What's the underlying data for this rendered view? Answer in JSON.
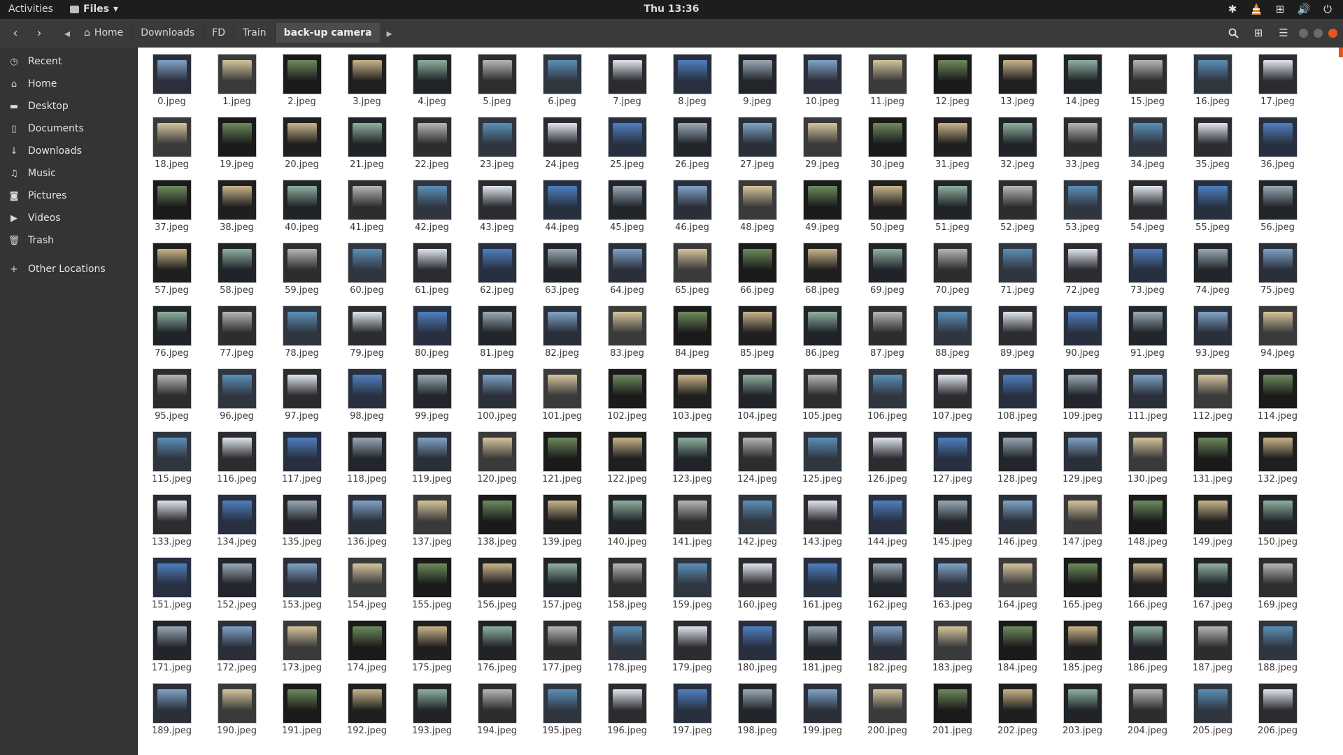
{
  "topbar": {
    "activities": "Activities",
    "app_name": "Files",
    "clock": "Thu 13:36",
    "tray_icons": [
      "settings-icon",
      "vlc-icon",
      "network-icon",
      "volume-icon",
      "power-icon"
    ]
  },
  "headerbar": {
    "breadcrumbs": [
      "Home",
      "Downloads",
      "FD",
      "Train",
      "back-up camera"
    ],
    "icons": [
      "back-icon",
      "forward-icon",
      "search-icon",
      "view-grid-icon",
      "menu-icon"
    ]
  },
  "sidebar": {
    "items": [
      {
        "label": "Recent",
        "icon": "clock-icon"
      },
      {
        "label": "Home",
        "icon": "home-icon"
      },
      {
        "label": "Desktop",
        "icon": "folder-icon"
      },
      {
        "label": "Documents",
        "icon": "document-icon"
      },
      {
        "label": "Downloads",
        "icon": "download-icon"
      },
      {
        "label": "Music",
        "icon": "music-icon"
      },
      {
        "label": "Pictures",
        "icon": "camera-icon"
      },
      {
        "label": "Videos",
        "icon": "video-icon"
      },
      {
        "label": "Trash",
        "icon": "trash-icon"
      },
      {
        "label": "Other Locations",
        "icon": "plus-icon"
      }
    ]
  },
  "files": [
    "0.jpeg",
    "1.jpeg",
    "2.jpeg",
    "3.jpeg",
    "4.jpeg",
    "5.jpeg",
    "6.jpeg",
    "7.jpeg",
    "8.jpeg",
    "9.jpeg",
    "10.jpeg",
    "11.jpeg",
    "12.jpeg",
    "13.jpeg",
    "14.jpeg",
    "15.jpeg",
    "16.jpeg",
    "17.jpeg",
    "18.jpeg",
    "19.jpeg",
    "20.jpeg",
    "21.jpeg",
    "22.jpeg",
    "23.jpeg",
    "24.jpeg",
    "25.jpeg",
    "26.jpeg",
    "27.jpeg",
    "29.jpeg",
    "30.jpeg",
    "31.jpeg",
    "32.jpeg",
    "33.jpeg",
    "34.jpeg",
    "35.jpeg",
    "36.jpeg",
    "37.jpeg",
    "38.jpeg",
    "40.jpeg",
    "41.jpeg",
    "42.jpeg",
    "43.jpeg",
    "44.jpeg",
    "45.jpeg",
    "46.jpeg",
    "48.jpeg",
    "49.jpeg",
    "50.jpeg",
    "51.jpeg",
    "52.jpeg",
    "53.jpeg",
    "54.jpeg",
    "55.jpeg",
    "56.jpeg",
    "57.jpeg",
    "58.jpeg",
    "59.jpeg",
    "60.jpeg",
    "61.jpeg",
    "62.jpeg",
    "63.jpeg",
    "64.jpeg",
    "65.jpeg",
    "66.jpeg",
    "68.jpeg",
    "69.jpeg",
    "70.jpeg",
    "71.jpeg",
    "72.jpeg",
    "73.jpeg",
    "74.jpeg",
    "75.jpeg",
    "76.jpeg",
    "77.jpeg",
    "78.jpeg",
    "79.jpeg",
    "80.jpeg",
    "81.jpeg",
    "82.jpeg",
    "83.jpeg",
    "84.jpeg",
    "85.jpeg",
    "86.jpeg",
    "87.jpeg",
    "88.jpeg",
    "89.jpeg",
    "90.jpeg",
    "91.jpeg",
    "93.jpeg",
    "94.jpeg",
    "95.jpeg",
    "96.jpeg",
    "97.jpeg",
    "98.jpeg",
    "99.jpeg",
    "100.jpeg",
    "101.jpeg",
    "102.jpeg",
    "103.jpeg",
    "104.jpeg",
    "105.jpeg",
    "106.jpeg",
    "107.jpeg",
    "108.jpeg",
    "109.jpeg",
    "111.jpeg",
    "112.jpeg",
    "114.jpeg",
    "115.jpeg",
    "116.jpeg",
    "117.jpeg",
    "118.jpeg",
    "119.jpeg",
    "120.jpeg",
    "121.jpeg",
    "122.jpeg",
    "123.jpeg",
    "124.jpeg",
    "125.jpeg",
    "126.jpeg",
    "127.jpeg",
    "128.jpeg",
    "129.jpeg",
    "130.jpeg",
    "131.jpeg",
    "132.jpeg",
    "133.jpeg",
    "134.jpeg",
    "135.jpeg",
    "136.jpeg",
    "137.jpeg",
    "138.jpeg",
    "139.jpeg",
    "140.jpeg",
    "141.jpeg",
    "142.jpeg",
    "143.jpeg",
    "144.jpeg",
    "145.jpeg",
    "146.jpeg",
    "147.jpeg",
    "148.jpeg",
    "149.jpeg",
    "150.jpeg",
    "151.jpeg",
    "152.jpeg",
    "153.jpeg",
    "154.jpeg",
    "155.jpeg",
    "156.jpeg",
    "157.jpeg",
    "158.jpeg",
    "159.jpeg",
    "160.jpeg",
    "161.jpeg",
    "162.jpeg",
    "163.jpeg",
    "164.jpeg",
    "165.jpeg",
    "166.jpeg",
    "167.jpeg",
    "169.jpeg",
    "171.jpeg",
    "172.jpeg",
    "173.jpeg",
    "174.jpeg",
    "175.jpeg",
    "176.jpeg",
    "177.jpeg",
    "178.jpeg",
    "179.jpeg",
    "180.jpeg",
    "181.jpeg",
    "182.jpeg",
    "183.jpeg",
    "184.jpeg",
    "185.jpeg",
    "186.jpeg",
    "187.jpeg",
    "188.jpeg",
    "189.jpeg",
    "190.jpeg",
    "191.jpeg",
    "192.jpeg",
    "193.jpeg",
    "194.jpeg",
    "195.jpeg",
    "196.jpeg",
    "197.jpeg",
    "198.jpeg",
    "199.jpeg",
    "200.jpeg",
    "201.jpeg",
    "202.jpeg",
    "203.jpeg",
    "204.jpeg",
    "205.jpeg",
    "206.jpeg"
  ],
  "colors": {
    "accent": "#e95420",
    "topbar": "#1d1d1d",
    "headerbar": "#3a3a3a",
    "sidebar": "#343434",
    "content_bg": "#ffffff"
  }
}
